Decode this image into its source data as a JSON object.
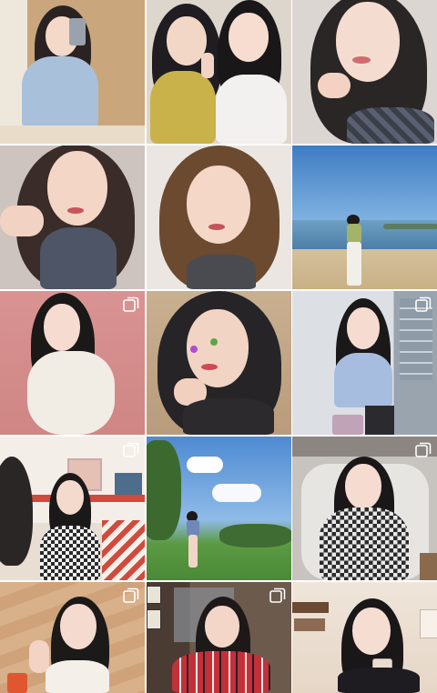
{
  "grid": {
    "tiles": [
      {
        "id": 1,
        "scene": "mirror-selfie",
        "multi": false,
        "colors": {
          "bg": "#c9a37a",
          "accent": "#8fb0d4"
        }
      },
      {
        "id": 2,
        "scene": "two-girls-peace-sign",
        "multi": false,
        "colors": {
          "bg": "#d9d0c4",
          "accent": "#c9b24a"
        }
      },
      {
        "id": 3,
        "scene": "closeup-finger-on-lip",
        "multi": false,
        "colors": {
          "bg": "#d7d2cd",
          "accent": "#3b3f4a"
        }
      },
      {
        "id": 4,
        "scene": "closeup-turtleneck",
        "multi": false,
        "colors": {
          "bg": "#cfc6c1",
          "accent": "#4e5566"
        }
      },
      {
        "id": 5,
        "scene": "closeup-long-hair",
        "multi": false,
        "colors": {
          "bg": "#e6e1dc",
          "accent": "#6e4d33"
        }
      },
      {
        "id": 6,
        "scene": "beach",
        "multi": false,
        "colors": {
          "bg": "#4f86c4",
          "accent": "#d9c7a4"
        }
      },
      {
        "id": 7,
        "scene": "pink-wall-fur-coat",
        "multi": true,
        "colors": {
          "bg": "#d9908f",
          "accent": "#f1ece6"
        }
      },
      {
        "id": 8,
        "scene": "face-stickers-selfie",
        "multi": false,
        "colors": {
          "bg": "#cbb59a",
          "accent": "#2c2a2d"
        }
      },
      {
        "id": 9,
        "scene": "blue-top-window",
        "multi": true,
        "colors": {
          "bg": "#cfd3d8",
          "accent": "#9fb5d6"
        }
      },
      {
        "id": 10,
        "scene": "cafe-checkered-top",
        "multi": true,
        "colors": {
          "bg": "#f3ede6",
          "accent": "#d04a3e"
        }
      },
      {
        "id": 11,
        "scene": "park-sky",
        "multi": false,
        "colors": {
          "bg": "#5b93d6",
          "accent": "#4f8f3b"
        }
      },
      {
        "id": 12,
        "scene": "armchair-plaid-dress",
        "multi": true,
        "colors": {
          "bg": "#b7b3ae",
          "accent": "#e8e6e3"
        }
      },
      {
        "id": 13,
        "scene": "wood-wall-drink",
        "multi": true,
        "colors": {
          "bg": "#d9b28c",
          "accent": "#e0572f"
        }
      },
      {
        "id": 14,
        "scene": "restaurant-red-plaid",
        "multi": true,
        "colors": {
          "bg": "#5c4a3e",
          "accent": "#c2313a"
        }
      },
      {
        "id": 15,
        "scene": "cafe-latte",
        "multi": false,
        "colors": {
          "bg": "#f0e6dc",
          "accent": "#6a4a33"
        }
      }
    ]
  }
}
